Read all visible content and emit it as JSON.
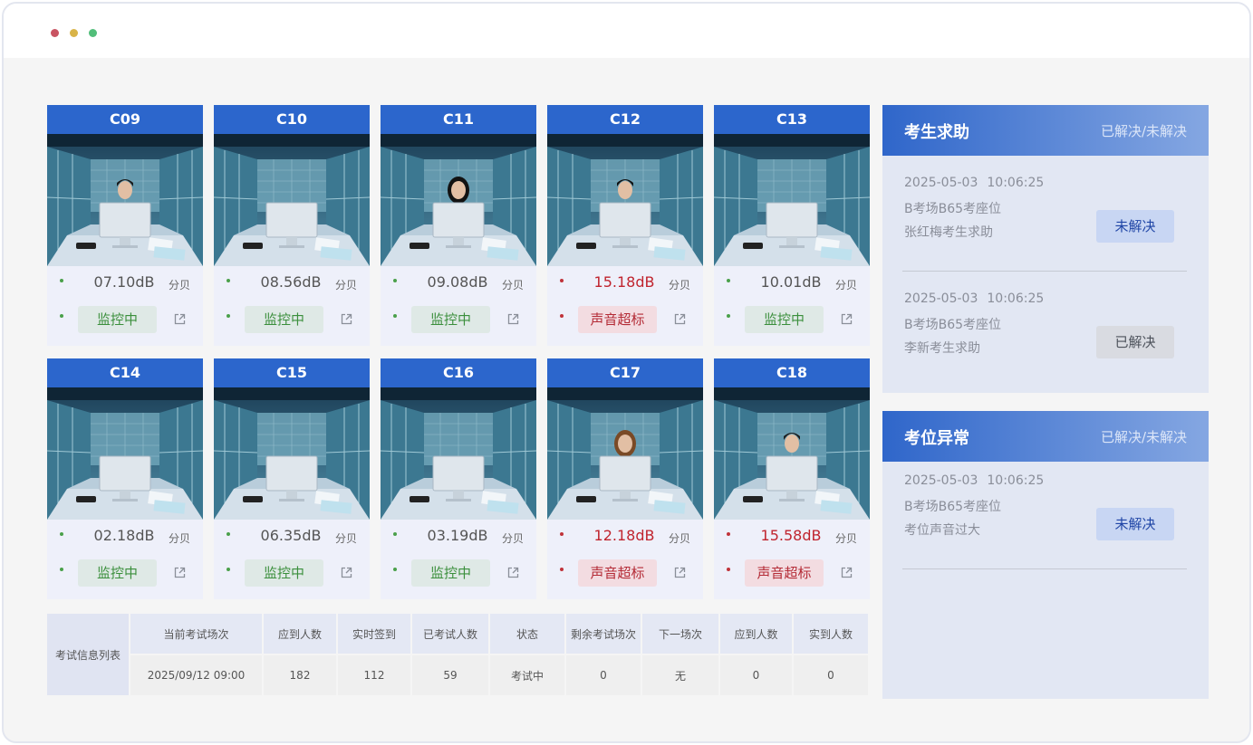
{
  "cameras": [
    {
      "id": "C09",
      "db": "07.10dB",
      "unit": "分贝",
      "status": "监控中",
      "alert": false,
      "person": "man1"
    },
    {
      "id": "C10",
      "db": "08.56dB",
      "unit": "分贝",
      "status": "监控中",
      "alert": false,
      "person": "none"
    },
    {
      "id": "C11",
      "db": "09.08dB",
      "unit": "分贝",
      "status": "监控中",
      "alert": false,
      "person": "woman1"
    },
    {
      "id": "C12",
      "db": "15.18dB",
      "unit": "分贝",
      "status": "声音超标",
      "alert": true,
      "person": "man2"
    },
    {
      "id": "C13",
      "db": "10.01dB",
      "unit": "分贝",
      "status": "监控中",
      "alert": false,
      "person": "none"
    },
    {
      "id": "C14",
      "db": "02.18dB",
      "unit": "分贝",
      "status": "监控中",
      "alert": false,
      "person": "none"
    },
    {
      "id": "C15",
      "db": "06.35dB",
      "unit": "分贝",
      "status": "监控中",
      "alert": false,
      "person": "none"
    },
    {
      "id": "C16",
      "db": "03.19dB",
      "unit": "分贝",
      "status": "监控中",
      "alert": false,
      "person": "none"
    },
    {
      "id": "C17",
      "db": "12.18dB",
      "unit": "分贝",
      "status": "声音超标",
      "alert": true,
      "person": "woman2"
    },
    {
      "id": "C18",
      "db": "15.58dB",
      "unit": "分贝",
      "status": "声音超标",
      "alert": true,
      "person": "man3"
    }
  ],
  "exam_table": {
    "title": "考试信息列表",
    "headers": [
      "当前考试场次",
      "应到人数",
      "实时签到",
      "已考试人数",
      "状态",
      "剩余考试场次",
      "下一场次",
      "应到人数",
      "实到人数"
    ],
    "values": [
      "2025/09/12  09:00",
      "182",
      "112",
      "59",
      "考试中",
      "0",
      "无",
      "0",
      "0"
    ]
  },
  "help_panel": {
    "title": "考生求助",
    "filter": "已解决/未解决",
    "entries": [
      {
        "date": "2025-05-03",
        "time": "10:06:25",
        "location": "B考场B65考座位",
        "desc": "张红梅考生求助",
        "action": "未解决",
        "resolved": false
      },
      {
        "date": "2025-05-03",
        "time": "10:06:25",
        "location": "B考场B65考座位",
        "desc": "李新考生求助",
        "action": "已解决",
        "resolved": true
      }
    ]
  },
  "seat_panel": {
    "title": "考位异常",
    "filter": "已解决/未解决",
    "entries": [
      {
        "date": "2025-05-03",
        "time": "10:06:25",
        "location": "B考场B65考座位",
        "desc": "考位声音过大",
        "action": "未解决",
        "resolved": false
      }
    ]
  },
  "colors": {
    "accent": "#2c66cc",
    "ok": "#3b8f3c",
    "alert": "#c0242e"
  }
}
